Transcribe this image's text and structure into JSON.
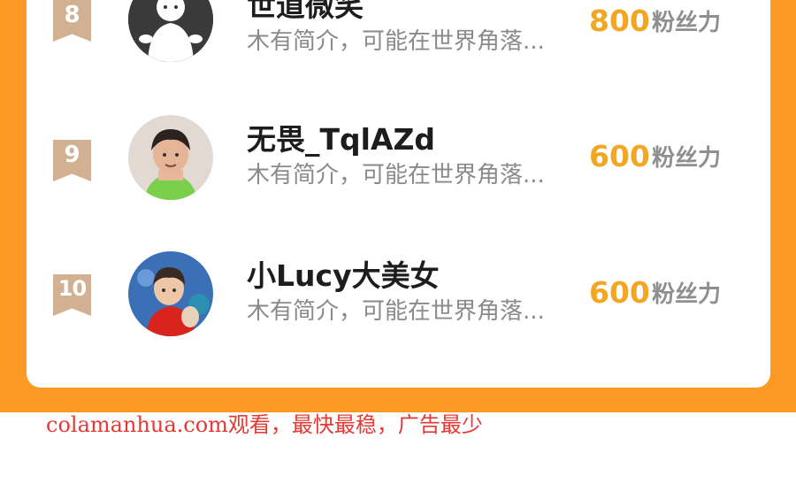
{
  "ranking": {
    "unit_label": "粉丝力",
    "items": [
      {
        "rank": "8",
        "name": "世道微笑",
        "bio": "木有简介，可能在世界角落...",
        "score": "800",
        "avatar": "ghost-avatar"
      },
      {
        "rank": "9",
        "name": "无畏_TqlAZd",
        "bio": "木有简介，可能在世界角落...",
        "score": "600",
        "avatar": "child-photo-avatar"
      },
      {
        "rank": "10",
        "name": "小Lucy大美女",
        "bio": "木有简介，可能在世界角落...",
        "score": "600",
        "avatar": "child-red-vest-avatar"
      }
    ]
  },
  "colors": {
    "page_bg": "#fd9a25",
    "card_bg": "#ffffff",
    "badge": "#d2b193",
    "score": "#f3a623",
    "footer": "#e53935"
  },
  "footer": {
    "text": "colamanhua.com观看，最快最稳，广告最少"
  }
}
